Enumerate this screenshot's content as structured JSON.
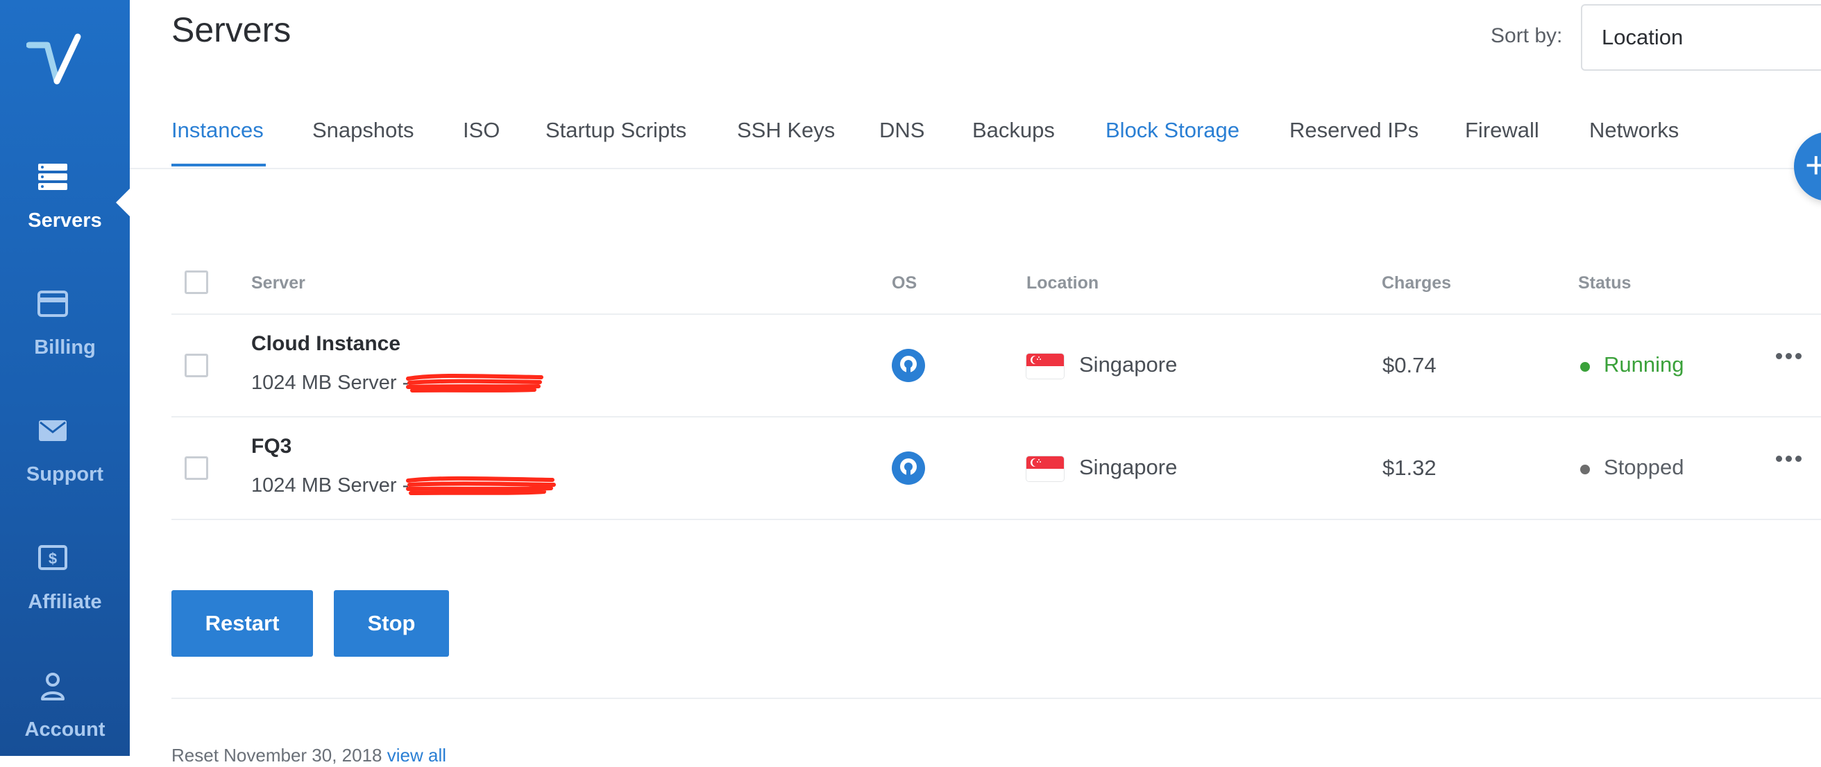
{
  "colors": {
    "accent": "#2a7fd4",
    "sidebar": "#1f6fc6",
    "running": "#3aa13a",
    "stopped": "#6d6d6d"
  },
  "sidebar": {
    "logo": "vultr-logo",
    "items": [
      {
        "label": "Servers",
        "icon": "server-stack-icon",
        "active": true
      },
      {
        "label": "Billing",
        "icon": "credit-card-icon",
        "active": false
      },
      {
        "label": "Support",
        "icon": "envelope-icon",
        "active": false
      },
      {
        "label": "Affiliate",
        "icon": "dollar-badge-icon",
        "active": false
      },
      {
        "label": "Account",
        "icon": "user-icon",
        "active": false
      }
    ]
  },
  "header": {
    "title": "Servers",
    "sort_label": "Sort by:",
    "sort_value": "Location"
  },
  "tabs": [
    {
      "label": "Instances",
      "active": true
    },
    {
      "label": "Snapshots"
    },
    {
      "label": "ISO"
    },
    {
      "label": "Startup Scripts"
    },
    {
      "label": "SSH Keys"
    },
    {
      "label": "DNS"
    },
    {
      "label": "Backups"
    },
    {
      "label": "Block Storage",
      "highlight": true
    },
    {
      "label": "Reserved IPs"
    },
    {
      "label": "Firewall"
    },
    {
      "label": "Networks"
    }
  ],
  "table": {
    "columns": [
      "Server",
      "OS",
      "Location",
      "Charges",
      "Status"
    ],
    "rows": [
      {
        "name": "Cloud Instance",
        "desc": "1024 MB Server -",
        "os_icon": "openvpn-icon",
        "location": "Singapore",
        "flag": "singapore-flag-icon",
        "charges": "$0.74",
        "status": "Running"
      },
      {
        "name": "FQ3",
        "desc": "1024 MB Server -",
        "os_icon": "openvpn-icon",
        "location": "Singapore",
        "flag": "singapore-flag-icon",
        "charges": "$1.32",
        "status": "Stopped"
      }
    ]
  },
  "actions": {
    "restart": "Restart",
    "stop": "Stop"
  },
  "footer": {
    "text": "Reset November 30, 2018",
    "link": "view all"
  }
}
